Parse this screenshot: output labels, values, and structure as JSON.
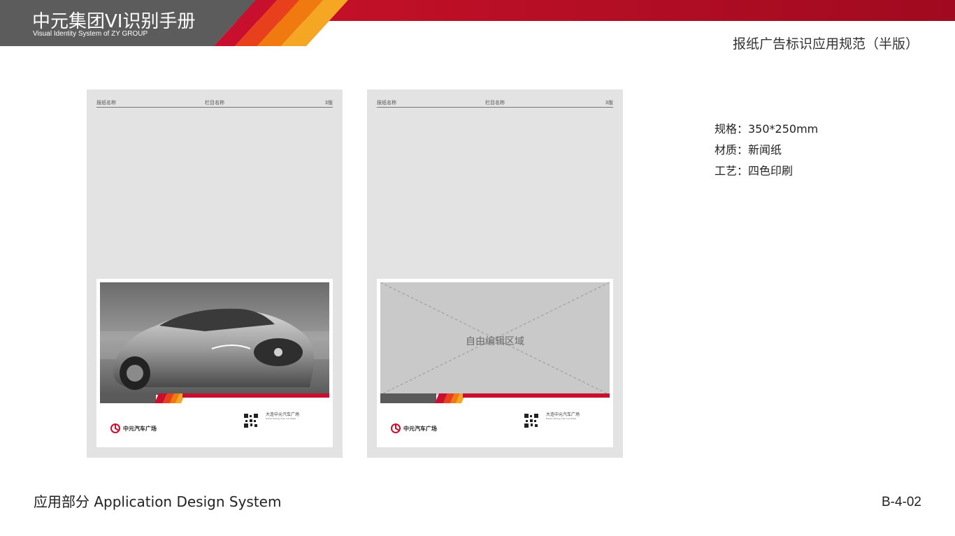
{
  "header": {
    "title": "中元集团VI识别手册",
    "subtitle": "Visual Identity System of ZY GROUP"
  },
  "section_title": "报纸广告标识应用规范（半版）",
  "specs": [
    "规格：350*250mm",
    "材质：新闻纸",
    "工艺：四色印刷"
  ],
  "footer": {
    "left": "应用部分 Application Design System",
    "right": "B-4-02"
  },
  "pages": [
    {
      "header_left": "报纸名称",
      "header_center": "栏目名称",
      "header_right": "3版",
      "ad_image": "car-photo",
      "logo_text": "中元汽车广场",
      "info_title": "大连中元汽车广场",
      "info_subtitle": "Dalian Zhong Yuan Car Plaza"
    },
    {
      "header_left": "报纸名称",
      "header_center": "栏目名称",
      "header_right": "3版",
      "placeholder_label": "自由编辑区域",
      "logo_text": "中元汽车广场",
      "info_title": "大连中元汽车广场",
      "info_subtitle": "Dalian Zhong Yuan Car Plaza"
    }
  ],
  "colors": {
    "header_gray": "#5a5a5a",
    "brand_red": "#c8102e",
    "orange": "#f39c12",
    "page_gray": "#e3e3e3"
  }
}
